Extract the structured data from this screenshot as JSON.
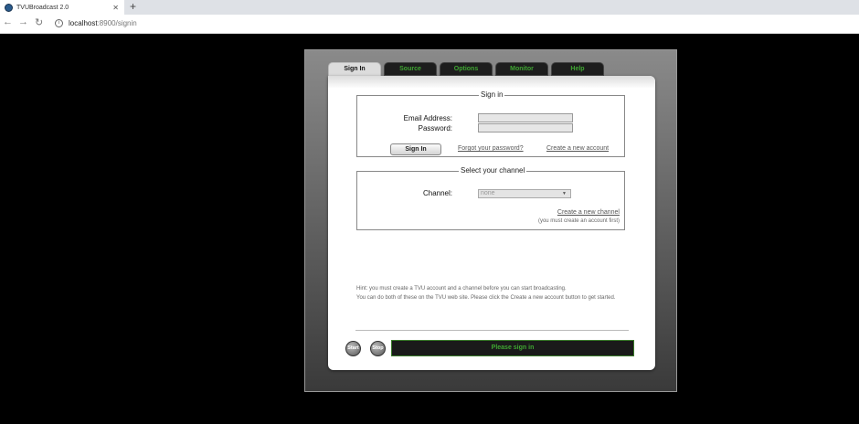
{
  "browser": {
    "tab_title": "TVUBroadcast 2.0",
    "tab_close": "✕",
    "new_tab": "+",
    "url_host": "localhost",
    "url_path": ":8900/signin"
  },
  "tabs": [
    {
      "label": "Sign In"
    },
    {
      "label": "Source"
    },
    {
      "label": "Options"
    },
    {
      "label": "Monitor"
    },
    {
      "label": "Help"
    }
  ],
  "signin": {
    "legend": "Sign in",
    "email_label": "Email Address:",
    "password_label": "Password:",
    "email_value": "",
    "password_value": "",
    "button": "Sign In",
    "forgot_link": "Forgot your password?",
    "create_account_link": "Create a new account"
  },
  "channel": {
    "legend": "Select your channel",
    "label": "Channel:",
    "selected": "none",
    "create_link": "Create a new channel",
    "note": "(you must create an account first)"
  },
  "hint": {
    "line1": "Hint: you must create a TVU account and a channel before you can start broadcasting.",
    "line2": "You can do both of these on the TVU web site. Please click the Create a new account button to get started."
  },
  "footer": {
    "start": "Start",
    "stop": "Stop",
    "status": "Please sign in"
  },
  "colors": {
    "accent_green": "#3fa532",
    "tab_dark": "#1d1d1d"
  }
}
